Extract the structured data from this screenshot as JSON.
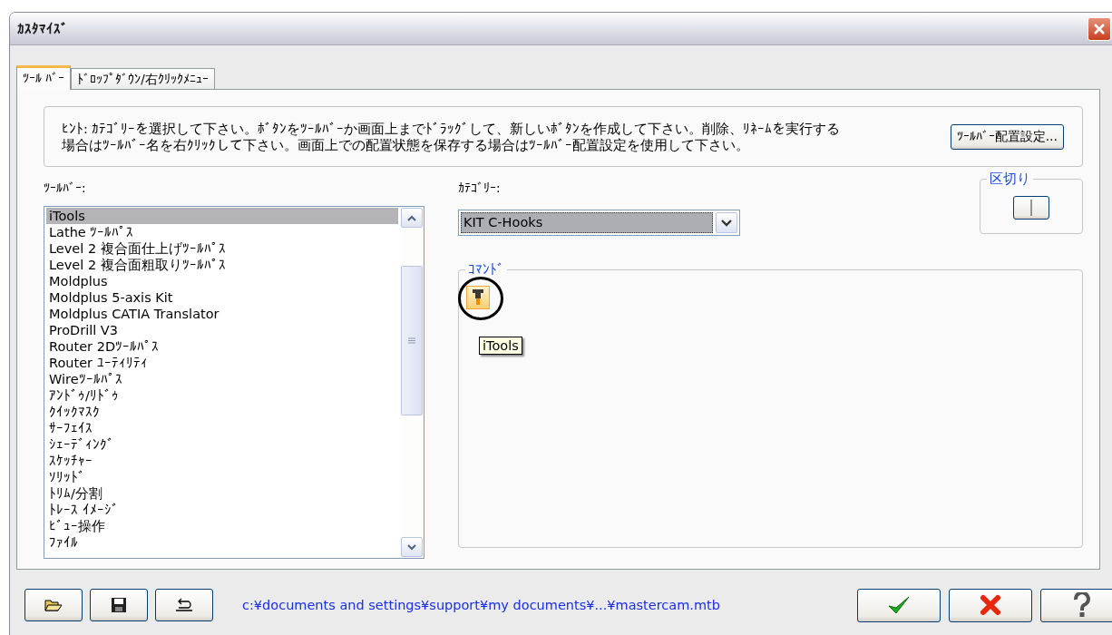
{
  "window": {
    "title": "ｶｽﾀﾏｲｽﾞ"
  },
  "tabs": [
    {
      "label": "ﾂｰﾙ ﾊﾞｰ",
      "selected": true
    },
    {
      "label": "ﾄﾞﾛｯﾌﾟﾀﾞｳﾝ/右ｸﾘｯｸﾒﾆｭｰ",
      "selected": false
    }
  ],
  "hint": {
    "lines": [
      "ﾋﾝﾄ: ｶﾃｺﾞﾘｰを選択して下さい。ﾎﾞﾀﾝをﾂｰﾙﾊﾞｰか画面上までﾄﾞﾗｯｸﾞして、新しいﾎﾞﾀﾝを作成して下さい。削除、ﾘﾈｰﾑを実行する",
      "場合はﾂｰﾙﾊﾞｰ名を右ｸﾘｯｸして下さい。画面上での配置状態を保存する場合はﾂｰﾙﾊﾞｰ配置設定を使用して下さい。"
    ],
    "button": "ﾂｰﾙﾊﾞｰ配置設定..."
  },
  "toolbars": {
    "label": "ﾂｰﾙﾊﾞｰ:",
    "items": [
      {
        "label": "iTools",
        "selected": true
      },
      {
        "label": "Lathe ﾂｰﾙﾊﾟｽ",
        "selected": false
      },
      {
        "label": "Level 2 複合面仕上げﾂｰﾙﾊﾟｽ",
        "selected": false
      },
      {
        "label": "Level 2 複合面粗取りﾂｰﾙﾊﾟｽ",
        "selected": false
      },
      {
        "label": "Moldplus",
        "selected": false
      },
      {
        "label": "Moldplus 5-axis Kit",
        "selected": false
      },
      {
        "label": "Moldplus CATIA Translator",
        "selected": false
      },
      {
        "label": "ProDrill V3",
        "selected": false
      },
      {
        "label": "Router 2Dﾂｰﾙﾊﾟｽ",
        "selected": false
      },
      {
        "label": "Router ﾕｰﾃｨﾘﾃｨ",
        "selected": false
      },
      {
        "label": "Wireﾂｰﾙﾊﾟｽ",
        "selected": false
      },
      {
        "label": "ｱﾝﾄﾞｩ/ﾘﾄﾞｩ",
        "selected": false
      },
      {
        "label": "ｸｲｯｸﾏｽｸ",
        "selected": false
      },
      {
        "label": "ｻｰﾌｪｲｽ",
        "selected": false
      },
      {
        "label": "ｼｪｰﾃﾞｨﾝｸﾞ",
        "selected": false
      },
      {
        "label": "ｽｹｯﾁｬｰ",
        "selected": false
      },
      {
        "label": "ｿﾘｯﾄﾞ",
        "selected": false
      },
      {
        "label": "ﾄﾘﾑ/分割",
        "selected": false
      },
      {
        "label": "ﾄﾚｰｽ ｲﾒｰｼﾞ",
        "selected": false
      },
      {
        "label": "ﾋﾞｭｰ操作",
        "selected": false
      },
      {
        "label": "ﾌｧｲﾙ",
        "selected": false
      }
    ]
  },
  "category": {
    "label": "ｶﾃｺﾞﾘｰ:",
    "value": "KIT C-Hooks"
  },
  "separator": {
    "label": "区切り"
  },
  "commands": {
    "label": "ｺﾏﾝﾄﾞ",
    "tooltip": "iTools"
  },
  "file_path": "c:¥documents and settings¥support¥my documents¥...¥mastercam.mtb"
}
